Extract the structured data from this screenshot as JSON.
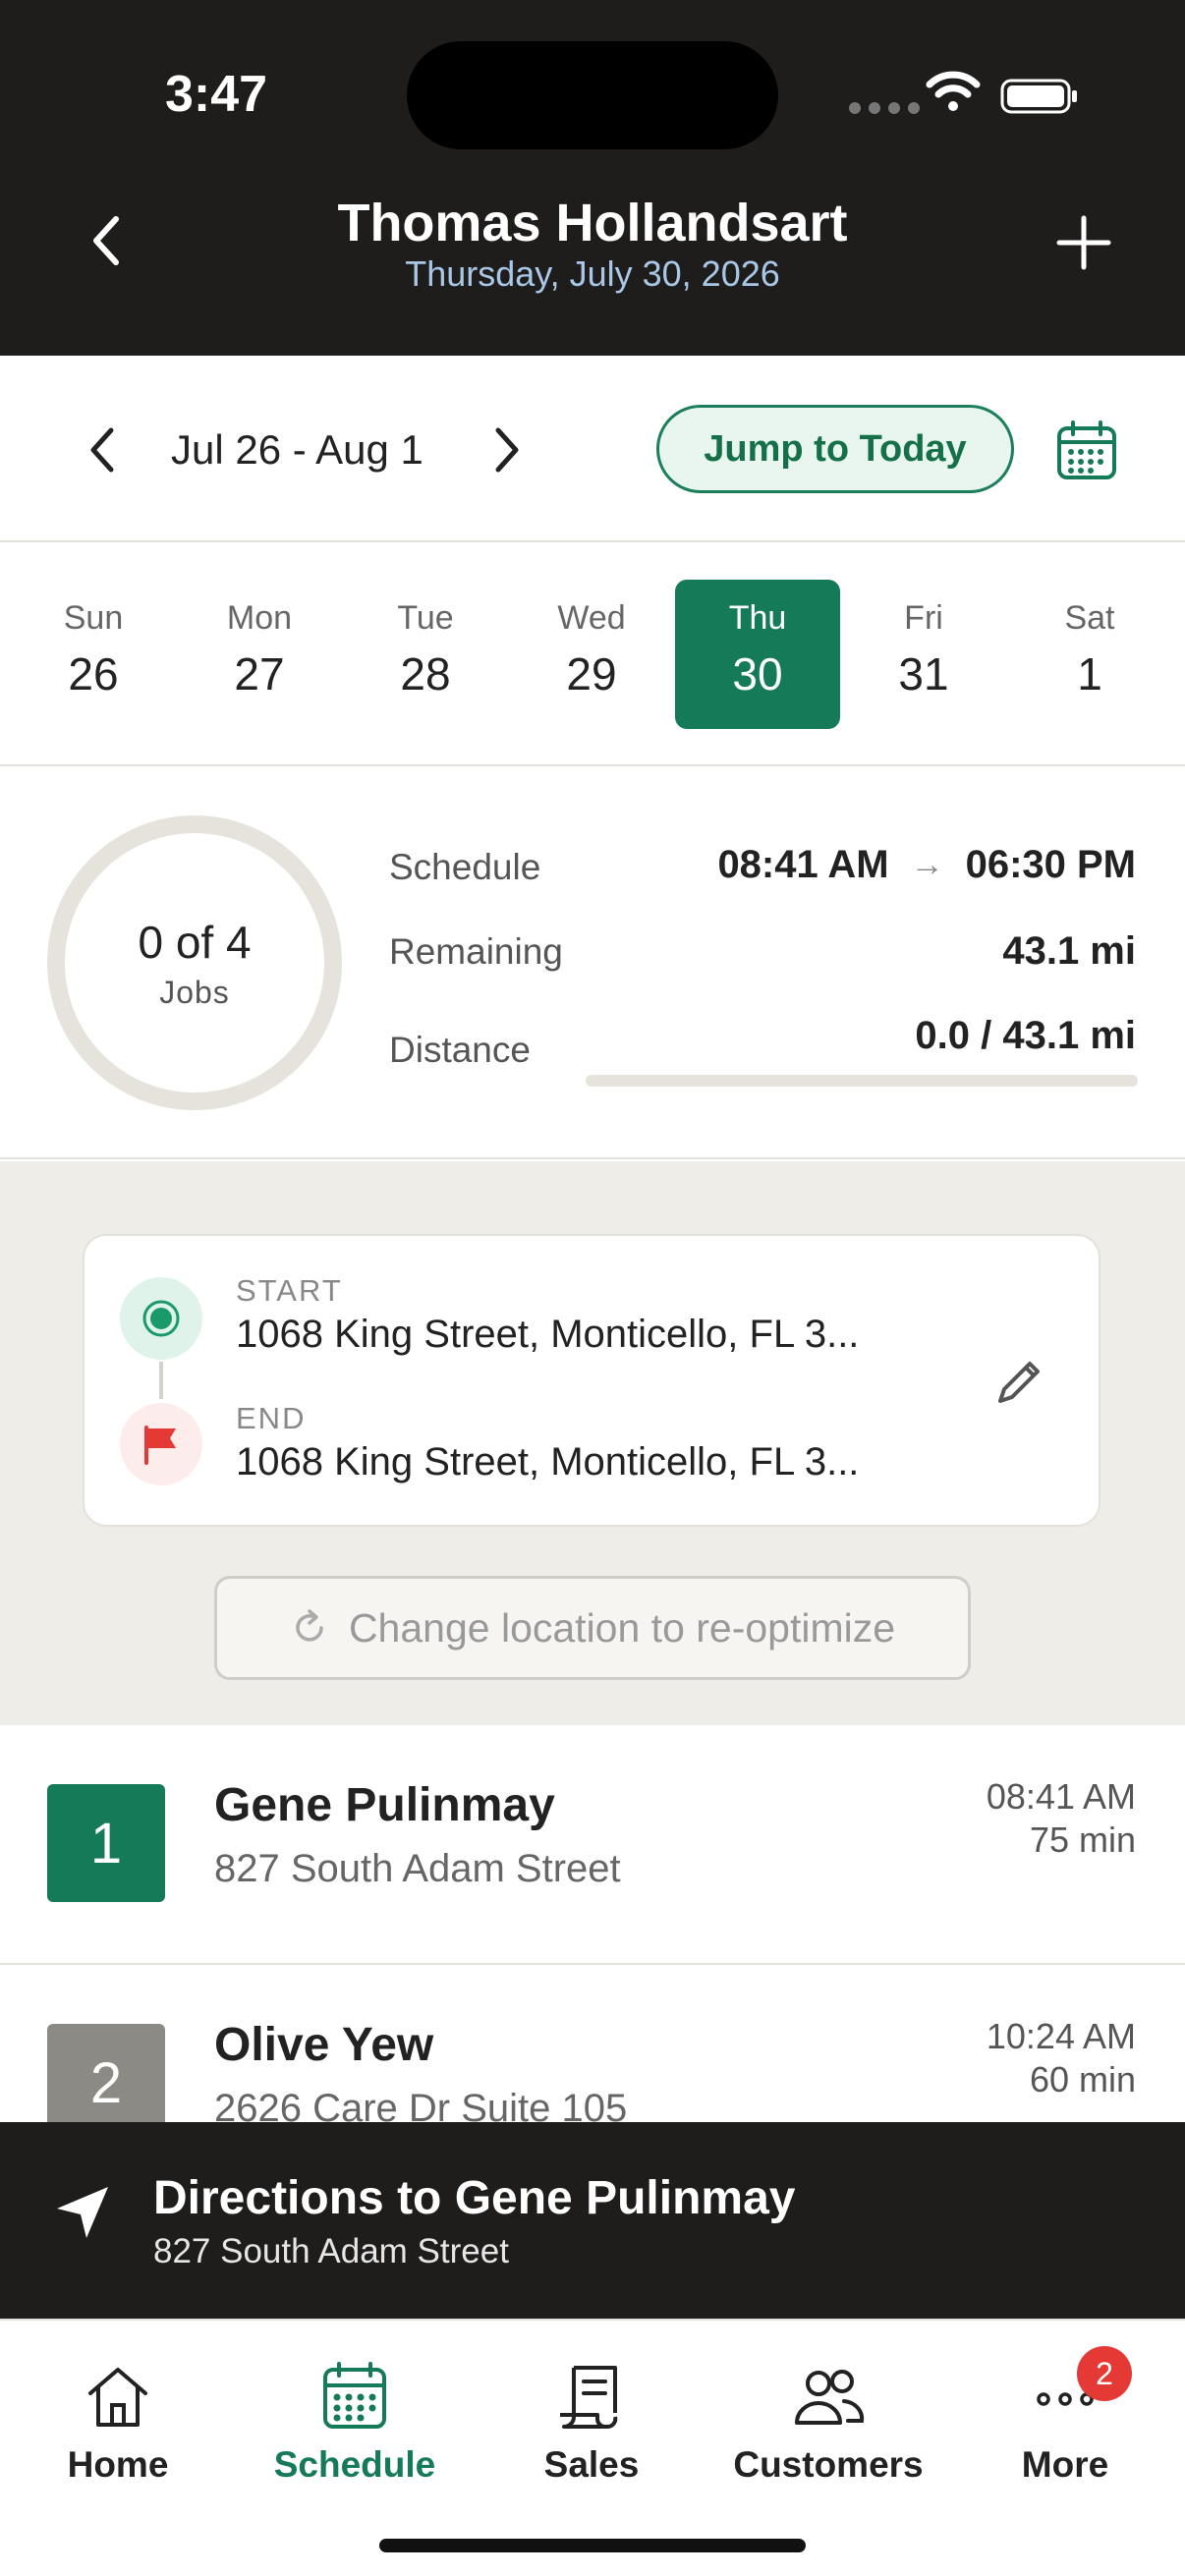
{
  "status_bar": {
    "time": "3:47"
  },
  "header": {
    "title": "Thomas Hollandsart",
    "subtitle": "Thursday, July 30, 2026"
  },
  "week_nav": {
    "range": "Jul 26 - Aug 1",
    "jump_label": "Jump to Today"
  },
  "days": [
    {
      "name": "Sun",
      "date": "26",
      "selected": false
    },
    {
      "name": "Mon",
      "date": "27",
      "selected": false
    },
    {
      "name": "Tue",
      "date": "28",
      "selected": false
    },
    {
      "name": "Wed",
      "date": "29",
      "selected": false
    },
    {
      "name": "Thu",
      "date": "30",
      "selected": true
    },
    {
      "name": "Fri",
      "date": "31",
      "selected": false
    },
    {
      "name": "Sat",
      "date": "1",
      "selected": false
    }
  ],
  "summary": {
    "jobs_done": "0 of 4",
    "jobs_label": "Jobs",
    "schedule_label": "Schedule",
    "schedule_start": "08:41 AM",
    "schedule_end": "06:30 PM",
    "remaining_label": "Remaining",
    "remaining_value": "43.1 mi",
    "distance_label": "Distance",
    "distance_value": "0.0 / 43.1 mi",
    "distance_progress": 0.0
  },
  "route": {
    "start_caption": "START",
    "start_address": "1068 King Street, Monticello, FL 3...",
    "end_caption": "END",
    "end_address": "1068 King Street, Monticello, FL 3...",
    "reoptimize_label": "Change location to re-optimize"
  },
  "jobs": [
    {
      "number": "1",
      "name": "Gene Pulinmay",
      "address": "827 South Adam Street",
      "time": "08:41 AM",
      "duration": "75 min",
      "color": "#157a57"
    },
    {
      "number": "2",
      "name": "Olive Yew",
      "address": "2626 Care Dr Suite 105",
      "time": "10:24 AM",
      "duration": "60 min",
      "color": "#8b8a85"
    }
  ],
  "directions": {
    "title": "Directions to Gene Pulinmay",
    "address": "827 South Adam Street"
  },
  "tabs": [
    {
      "label": "Home",
      "icon": "home-icon",
      "active": false
    },
    {
      "label": "Schedule",
      "icon": "calendar-icon",
      "active": true
    },
    {
      "label": "Sales",
      "icon": "receipt-icon",
      "active": false
    },
    {
      "label": "Customers",
      "icon": "people-icon",
      "active": false
    },
    {
      "label": "More",
      "icon": "more-icon",
      "active": false,
      "badge": "2"
    }
  ],
  "colors": {
    "accent": "#157a57",
    "header_bg": "#1e1d1b",
    "badge": "#e53935"
  }
}
